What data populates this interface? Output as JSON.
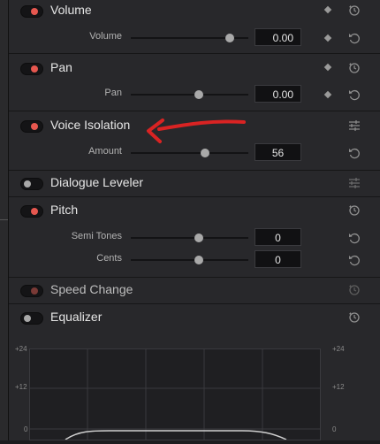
{
  "effects": [
    {
      "title": "Volume",
      "toggle": "on",
      "params": [
        {
          "label": "Volume",
          "value": "0.00",
          "slider_fraction": 0.84
        }
      ],
      "keyframe": true
    },
    {
      "title": "Pan",
      "toggle": "on",
      "params": [
        {
          "label": "Pan",
          "value": "0.00",
          "slider_fraction": 0.5
        }
      ],
      "keyframe": true
    },
    {
      "title": "Voice Isolation",
      "toggle": "on",
      "settings_icon": true,
      "params": [
        {
          "label": "Amount",
          "value": "56",
          "slider_fraction": 0.56
        }
      ]
    },
    {
      "title": "Dialogue Leveler",
      "toggle": "off",
      "settings_icon": true
    },
    {
      "title": "Pitch",
      "toggle": "on",
      "params": [
        {
          "label": "Semi Tones",
          "value": "0",
          "slider_fraction": 0.5
        },
        {
          "label": "Cents",
          "value": "0",
          "slider_fraction": 0.5
        }
      ]
    },
    {
      "title": "Speed Change",
      "toggle": "disabled"
    },
    {
      "title": "Equalizer",
      "toggle": "off"
    }
  ],
  "equalizer": {
    "left_scale": [
      "+24",
      "+12",
      "0"
    ],
    "right_scale": [
      "+24",
      "+12",
      "0"
    ]
  },
  "annotation": {
    "type": "red-arrow",
    "color": "#d92323",
    "points_to": "Voice Isolation"
  },
  "colors": {
    "toggle_on": "#e6574f",
    "panel": "#28282b"
  }
}
